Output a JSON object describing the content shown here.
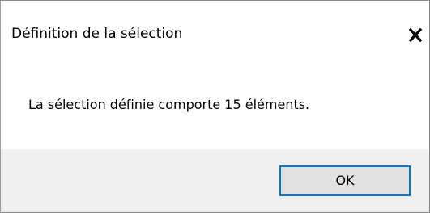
{
  "window": {
    "title": "Définition de la sélection"
  },
  "titlebar": {
    "close_icon": "close-icon"
  },
  "content": {
    "message": "La sélection définie comporte 15 éléments."
  },
  "footer": {
    "ok_label": "OK"
  },
  "colors": {
    "accent": "#0078d7",
    "footer_bg": "#f0f0f0",
    "button_bg": "#e1e1e1"
  }
}
